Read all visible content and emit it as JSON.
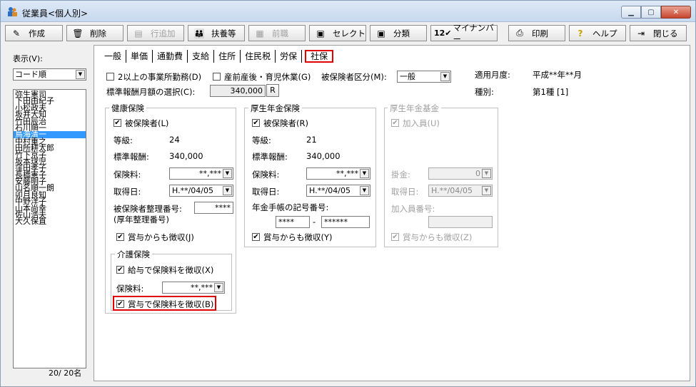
{
  "window": {
    "title": "従業員<個人別>"
  },
  "toolbar": {
    "create": "作成",
    "delete": "削除",
    "add_row": "行追加",
    "dependents": "扶養等",
    "former": "前職",
    "select": "セレクト",
    "classify": "分類",
    "mynumber": "マイナンバー",
    "print": "印刷",
    "help": "ヘルプ",
    "close": "閉じる"
  },
  "left": {
    "display_label": "表示(V):",
    "sort_value": "コード順",
    "employees": [
      "弥生憲司",
      "下田由紀子",
      "小松政夫",
      "坂井大知",
      "竹田辰治",
      "石川順一",
      "鳥海清一",
      "中村重之",
      "田所耕太郎",
      "竹下京子",
      "坂本球児",
      "窪田孝子",
      "長橋憲子",
      "安藤明子",
      "山名順一朗",
      "卯月良知",
      "中野洋子",
      "山本尚幸",
      "佐山浩夫",
      "大久保直"
    ],
    "selected_index": 6,
    "count": "20/ 20名"
  },
  "tabs": [
    "一般",
    "単価",
    "通勤費",
    "支給",
    "住所",
    "住民税",
    "労保",
    "社保"
  ],
  "top": {
    "multi_office": "2以上の事業所勤務(D)",
    "maternity": "産前産後・育児休業(G)",
    "insured_class_label": "被保険者区分(M):",
    "insured_class_value": "一般",
    "std_select_label": "標準報酬月額の選択(C):",
    "std_select_value": "340,000",
    "r_button": "R",
    "apply_month_label": "適用月度:",
    "apply_month_value": "平成**年**月",
    "kind_label": "種別:",
    "kind_value": "第1種 [1]"
  },
  "health": {
    "title": "健康保険",
    "insured": "被保険者(L)",
    "grade_label": "等級:",
    "grade_value": "24",
    "std_label": "標準報酬:",
    "std_value": "340,000",
    "premium_label": "保険料:",
    "premium_value": "**,***",
    "date_label": "取得日:",
    "date_value": "H.**/04/05",
    "number_label": "被保険者整理番号:",
    "number_sub": "(厚年整理番号)",
    "number_value": "****",
    "bonus": "賞与からも徴収(J)"
  },
  "care": {
    "title": "介護保険",
    "salary": "給与で保険料を徴収(X)",
    "premium_label": "保険料:",
    "premium_value": "**,***",
    "bonus": "賞与で保険料を徴収(B)"
  },
  "pension": {
    "title": "厚生年金保険",
    "insured": "被保険者(R)",
    "grade_label": "等級:",
    "grade_value": "21",
    "std_label": "標準報酬:",
    "std_value": "340,000",
    "premium_label": "保険料:",
    "premium_value": "**,***",
    "date_label": "取得日:",
    "date_value": "H.**/04/05",
    "book_label": "年金手帳の記号番号:",
    "book_value1": "****",
    "book_dash": "-",
    "book_value2": "******",
    "bonus": "賞与からも徴収(Y)"
  },
  "fund": {
    "title": "厚生年金基金",
    "member": "加入員(U)",
    "premium_label": "掛金:",
    "premium_value": "0",
    "date_label": "取得日:",
    "date_value": "H.**/04/05",
    "number_label": "加入員番号:",
    "bonus": "賞与からも徴収(Z)"
  }
}
